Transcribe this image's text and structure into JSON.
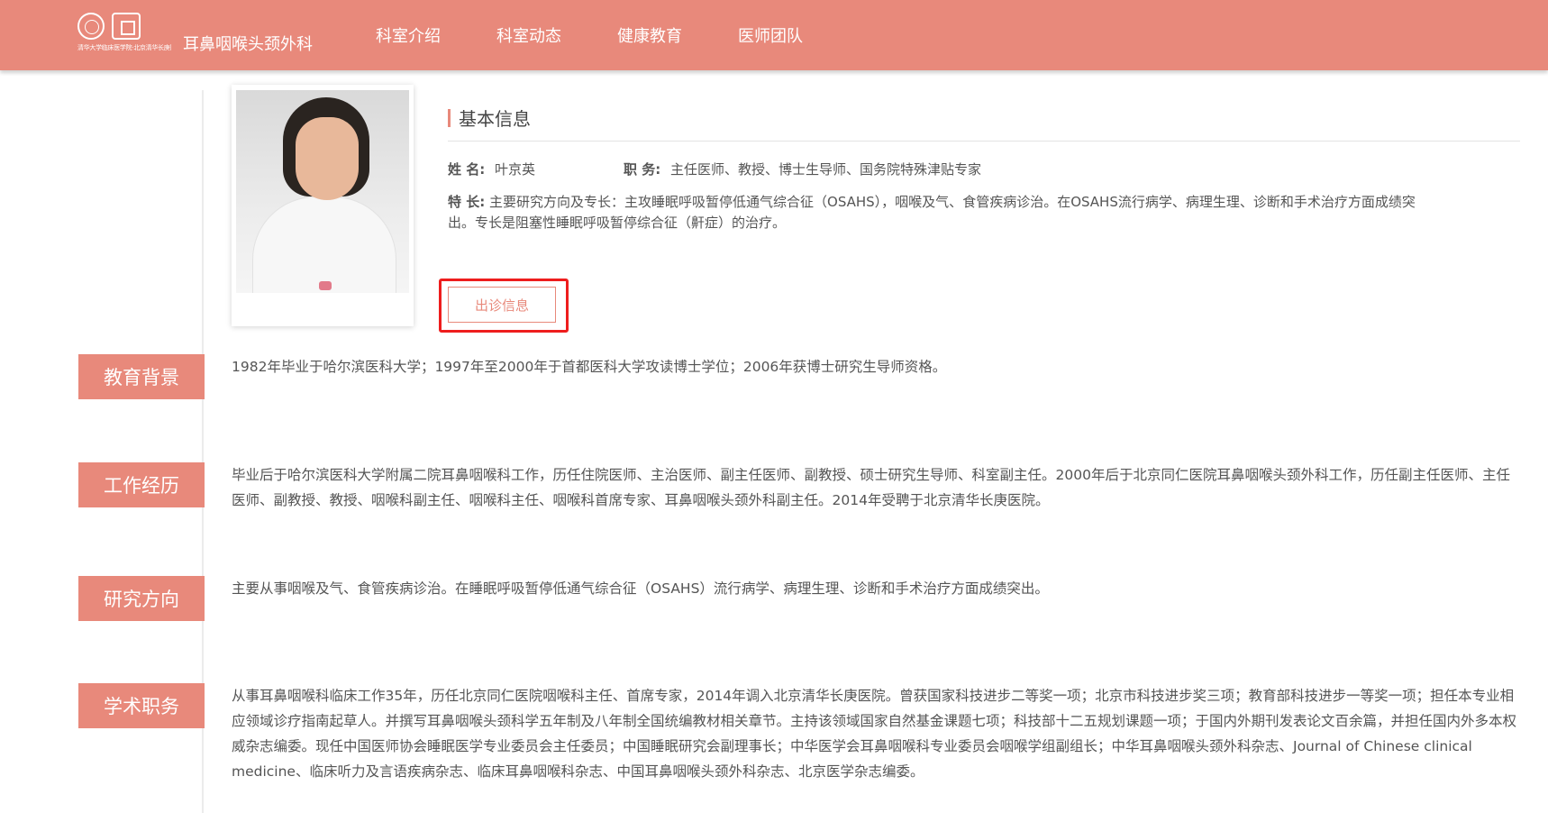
{
  "header": {
    "logo_caption": "清华大学临床医学院·北京清华长庚医院",
    "dept_name": "耳鼻咽喉头颈外科",
    "nav": [
      "科室介绍",
      "科室动态",
      "健康教育",
      "医师团队"
    ]
  },
  "colors": {
    "accent": "#e8897b",
    "highlight": "#ee1d1d"
  },
  "basic_info": {
    "title": "基本信息",
    "name_label": "姓 名:",
    "name": "叶京英",
    "position_label": "职 务:",
    "position": "主任医师、教授、博士生导师、国务院特殊津贴专家",
    "specialty_label": "特 长:",
    "specialty": "主要研究方向及专长：主攻睡眠呼吸暂停低通气综合征（OSAHS），咽喉及气、食管疾病诊治。在OSAHS流行病学、病理生理、诊断和手术治疗方面成绩突出。专长是阻塞性睡眠呼吸暂停综合征（鼾症）的治疗。"
  },
  "clinic_button": "出诊信息",
  "sections": [
    {
      "tag": "教育背景",
      "text": "1982年毕业于哈尔滨医科大学；1997年至2000年于首都医科大学攻读博士学位；2006年获博士研究生导师资格。"
    },
    {
      "tag": "工作经历",
      "text": "毕业后于哈尔滨医科大学附属二院耳鼻咽喉科工作，历任住院医师、主治医师、副主任医师、副教授、硕士研究生导师、科室副主任。2000年后于北京同仁医院耳鼻咽喉头颈外科工作，历任副主任医师、主任医师、副教授、教授、咽喉科副主任、咽喉科主任、咽喉科首席专家、耳鼻咽喉头颈外科副主任。2014年受聘于北京清华长庚医院。"
    },
    {
      "tag": "研究方向",
      "text": "主要从事咽喉及气、食管疾病诊治。在睡眠呼吸暂停低通气综合征（OSAHS）流行病学、病理生理、诊断和手术治疗方面成绩突出。"
    },
    {
      "tag": "学术职务",
      "text": "从事耳鼻咽喉科临床工作35年，历任北京同仁医院咽喉科主任、首席专家，2014年调入北京清华长庚医院。曾获国家科技进步二等奖一项；北京市科技进步奖三项；教育部科技进步一等奖一项；担任本专业相应领域诊疗指南起草人。并撰写耳鼻咽喉头颈科学五年制及八年制全国统编教材相关章节。主持该领域国家自然基金课题七项；科技部十二五规划课题一项；于国内外期刊发表论文百余篇，并担任国内外多本权威杂志编委。现任中国医师协会睡眠医学专业委员会主任委员；中国睡眠研究会副理事长；中华医学会耳鼻咽喉科专业委员会咽喉学组副组长；中华耳鼻咽喉头颈外科杂志、Journal of Chinese clinical medicine、临床听力及言语疾病杂志、临床耳鼻咽喉科杂志、中国耳鼻咽喉头颈外科杂志、北京医学杂志编委。"
    }
  ]
}
